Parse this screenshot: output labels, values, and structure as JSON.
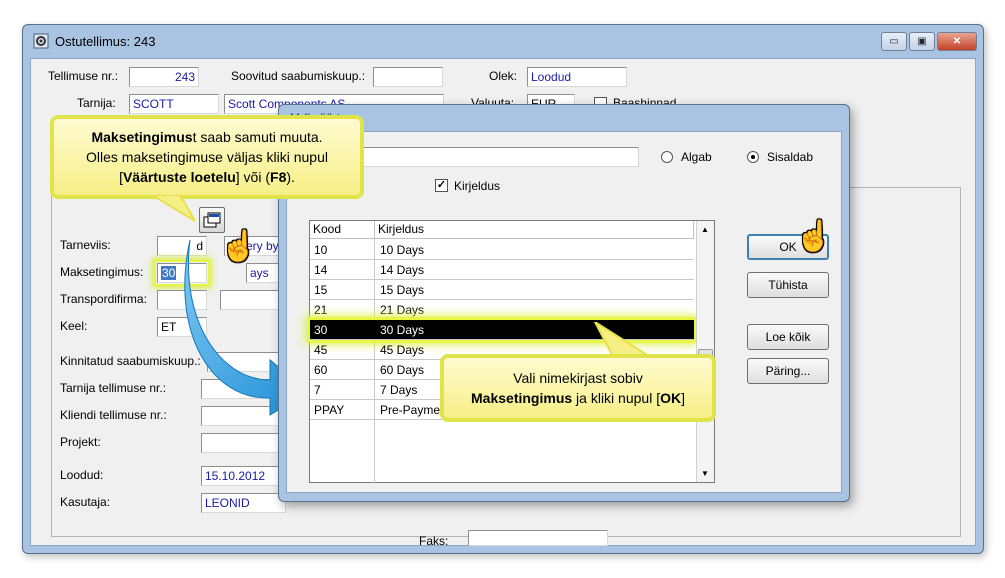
{
  "main_window": {
    "title": "Ostutellimus: 243",
    "minimize_glyph": "▭",
    "restore_glyph": "▣",
    "close_glyph": "✕",
    "fields": {
      "tellimuse_nr_label": "Tellimuse nr.:",
      "tellimuse_nr_value": "243",
      "soovitud_label": "Soovitud saabumiskuup.:",
      "soovitud_value": "",
      "olek_label": "Olek:",
      "olek_value": "Loodud",
      "tarnija_label": "Tarnija:",
      "tarnija_code": "SCOTT",
      "tarnija_name": "Scott Components AS",
      "valuuta_label": "Valuuta:",
      "valuuta_value": "EUR",
      "hinnad_label": "Baashinnad",
      "tarneviis_label": "Tarneviis:",
      "tarneviis_code": "d",
      "tarneviis_name": "elivery by",
      "maksetingimus_label": "Maksetingimus:",
      "maksetingimus_code": "30",
      "maksetingimus_name": "ays",
      "transpordifirma_label": "Transpordifirma:",
      "keel_label": "Keel:",
      "keel_value": "ET",
      "kinnitatud_label": "Kinnitatud saabumiskuup.:",
      "tarnija_tellimuse_label": "Tarnija tellimuse nr.:",
      "kliendi_tellimuse_label": "Kliendi tellimuse nr.:",
      "projekt_label": "Projekt:",
      "loodud_label": "Loodud:",
      "loodud_value": "15.10.2012",
      "kasutaja_label": "Kasutaja:",
      "kasutaja_value": "LEONID",
      "faks_label": "Faks:"
    }
  },
  "dialog": {
    "title": "Vali väärtus",
    "search_value": "",
    "radio_algab": "Algab",
    "radio_sisaldab": "Sisaldab",
    "selected_radio": "Sisaldab",
    "checkbox_kirjeldus": "Kirjeldus",
    "checkbox_kirjeldus_checked": true,
    "checkmark_glyph": "✓",
    "columns": [
      "Kood",
      "Kirjeldus"
    ],
    "rows": [
      {
        "kood": "10",
        "kirjeldus": "10 Days"
      },
      {
        "kood": "14",
        "kirjeldus": "14 Days"
      },
      {
        "kood": "15",
        "kirjeldus": "15 Days"
      },
      {
        "kood": "21",
        "kirjeldus": "21 Days"
      },
      {
        "kood": "30",
        "kirjeldus": "30 Days"
      },
      {
        "kood": "45",
        "kirjeldus": "45 Days"
      },
      {
        "kood": "60",
        "kirjeldus": "60 Days"
      },
      {
        "kood": "7",
        "kirjeldus": "7 Days"
      },
      {
        "kood": "PPAY",
        "kirjeldus": "Pre-Payment"
      }
    ],
    "selected_row_index": 4,
    "scroll_up_glyph": "▲",
    "scroll_down_glyph": "▼",
    "buttons": {
      "ok": "OK",
      "tuhista": "Tühista",
      "loe_koik": "Loe kõik",
      "paring": "Päring..."
    }
  },
  "callouts": {
    "top_left": {
      "part1_bold": "Maksetingimus",
      "part2": "t saab samuti muuta.",
      "part3": "Olles maksetingimuse väljas kliki nupul",
      "part4_open": "[",
      "part4_bold": "Väärtuste loetelu",
      "part4_mid": "] või (",
      "part4_bold2": "F8",
      "part4_end": ")."
    },
    "bottom_right": {
      "line1": "Vali nimekirjast sobiv",
      "part2_bold": "Maksetingimus",
      "part2_mid": " ja kliki nupul [",
      "part2_bold2": "OK",
      "part2_end": "]"
    }
  },
  "icons": {
    "app_icon": "gear-window-icon",
    "hand_glyph": "☝",
    "list_lookup_icon": "lookup-list-icon"
  },
  "colors": {
    "callout_fill": "#f6ef86",
    "highlight": "#e8f542",
    "selection": "#000000",
    "arrow_blue": "#1f8fd6"
  }
}
